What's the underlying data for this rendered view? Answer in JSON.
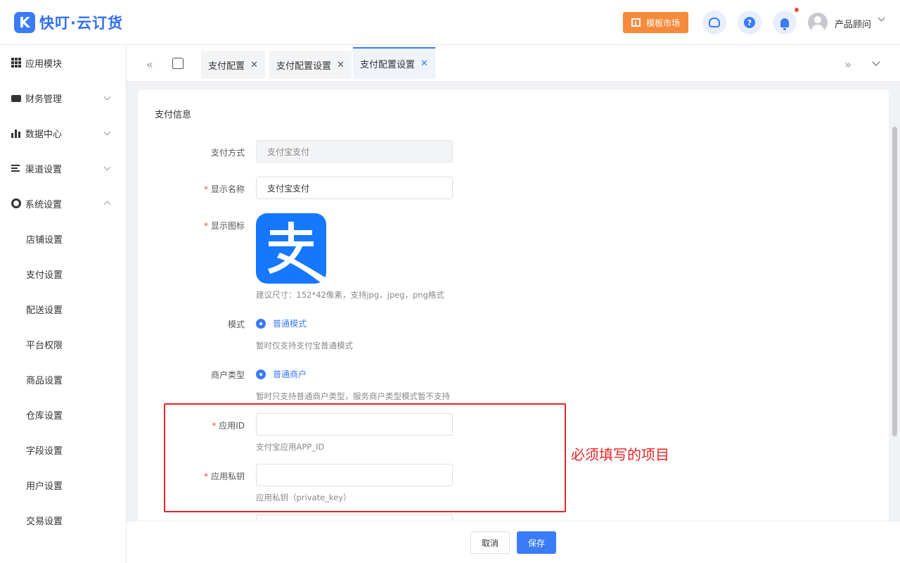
{
  "header": {
    "logo_mark": "K",
    "logo_text": "快叮·云订货",
    "market_button": "模板市场",
    "help_glyph": "?",
    "user_name": "产品顾问"
  },
  "sidebar": {
    "items": [
      {
        "label": "应用模块",
        "icon": "grid-icon"
      },
      {
        "label": "财务管理",
        "icon": "wallet-icon"
      },
      {
        "label": "数据中心",
        "icon": "bar-chart-icon"
      },
      {
        "label": "渠道设置",
        "icon": "list-icon"
      },
      {
        "label": "系统设置",
        "icon": "gear-icon"
      }
    ],
    "sub_items": [
      "店铺设置",
      "支付设置",
      "配送设置",
      "平台权限",
      "商品设置",
      "仓库设置",
      "字段设置",
      "用户设置",
      "交易设置"
    ]
  },
  "tabs": {
    "prev_glyph": "«",
    "next_glyph": "»",
    "close_glyph": "✕",
    "items": [
      "支付配置",
      "支付配置设置",
      "支付配置设置"
    ]
  },
  "form": {
    "section_title": "支付信息",
    "required_mark": "*",
    "pay_method_label": "支付方式",
    "pay_method_value": "支付宝支付",
    "display_name_label": "显示名称",
    "display_name_value": "支付宝支付",
    "display_icon_label": "显示图标",
    "icon_hint": "建议尺寸：152*42像素，支持jpg，jpeg，png格式",
    "mode_label": "模式",
    "mode_option": "普通模式",
    "mode_hint": "暂时仅支持支付宝普通模式",
    "merchant_type_label": "商户类型",
    "merchant_type_option": "普通商户",
    "merchant_type_hint": "暂时只支持普通商户类型，服务商户类型模式暂不支持",
    "app_id_label": "应用ID",
    "app_id_value": "",
    "app_id_hint": "支付宝应用APP_ID",
    "private_key_label": "应用私钥",
    "private_key_value": "",
    "private_key_hint": "应用私钥（private_key）"
  },
  "annotation": {
    "text": "必须填写的项目",
    "color": "#e62424"
  },
  "footer": {
    "cancel": "取消",
    "save": "保存"
  },
  "colors": {
    "primary": "#3a7bf7",
    "market": "#f68b3c",
    "alipay": "#1677ff"
  }
}
